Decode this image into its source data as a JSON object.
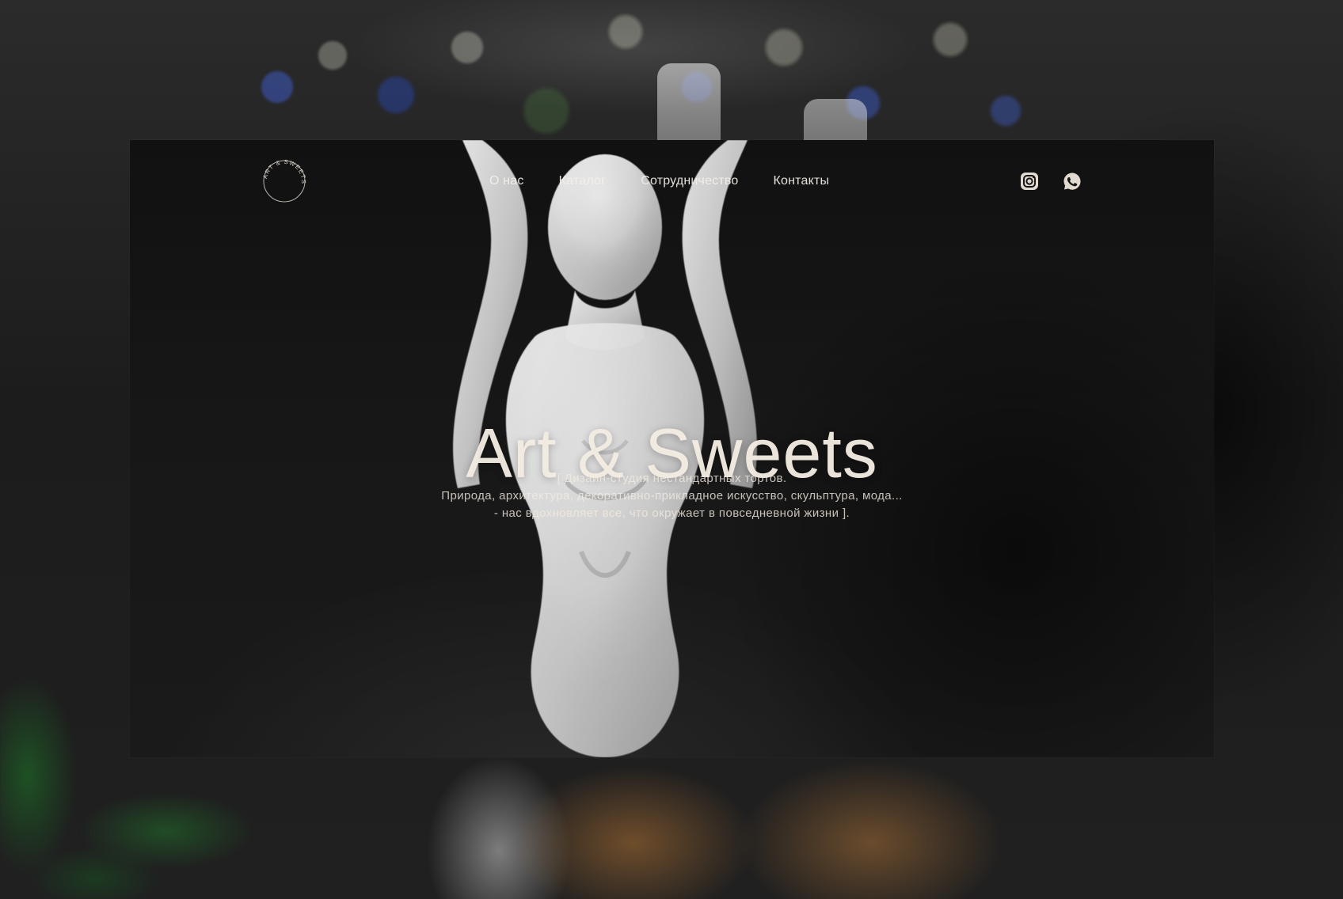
{
  "brand": {
    "logo_text": "ART & SWEETS",
    "title": "Art & Sweets"
  },
  "navigation": {
    "items": [
      {
        "label": "О нас"
      },
      {
        "label": "Каталог"
      },
      {
        "label": "Сотрудничество"
      },
      {
        "label": "Контакты"
      }
    ]
  },
  "social": {
    "items": [
      {
        "icon": "instagram-icon"
      },
      {
        "icon": "whatsapp-icon"
      }
    ]
  },
  "hero": {
    "subtitle_lines": [
      "[ Дизайн-студия нестандартных тортов.",
      "Природа, архитектура, декоративно-прикладное искусство, скульптура, мода...",
      "- нас вдохновляет все, что окружает в повседневной жизни ]."
    ]
  },
  "colors": {
    "text_primary": "#F4ECE2",
    "text_secondary": "#F2EBE1",
    "background": "#141414"
  }
}
